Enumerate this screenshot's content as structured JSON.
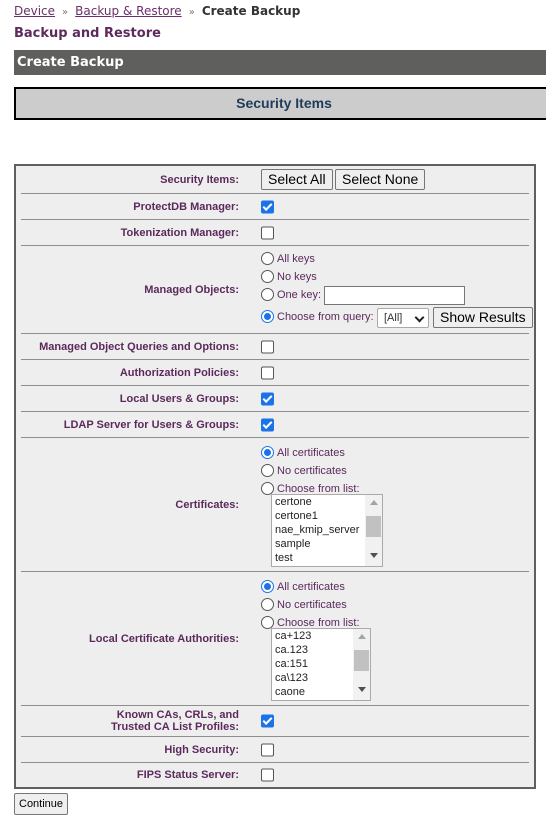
{
  "breadcrumb": {
    "items": [
      "Device",
      "Backup & Restore"
    ],
    "separator": "»",
    "current": "Create Backup"
  },
  "page_title": "Backup and Restore",
  "section_title": "Create Backup",
  "items_header": "Security Items",
  "form": {
    "security_items": {
      "label": "Security Items:",
      "select_all": "Select All",
      "select_none": "Select None"
    },
    "protectdb": {
      "label": "ProtectDB Manager:",
      "checked": true
    },
    "tokenization": {
      "label": "Tokenization Manager:",
      "checked": false
    },
    "managed_objects": {
      "label": "Managed Objects:",
      "options": [
        "All keys",
        "No keys",
        "One key:",
        "Choose from query:"
      ],
      "selected": "Choose from query:",
      "one_key_value": "",
      "query_select": "[All]",
      "show_results": "Show Results"
    },
    "mo_queries": {
      "label": "Managed Object Queries and Options:",
      "checked": false
    },
    "auth_policies": {
      "label": "Authorization Policies:",
      "checked": false
    },
    "local_users": {
      "label": "Local Users & Groups:",
      "checked": true
    },
    "ldap": {
      "label": "LDAP Server for Users & Groups:",
      "checked": true
    },
    "certificates": {
      "label": "Certificates:",
      "options": [
        "All certificates",
        "No certificates",
        "Choose from list:"
      ],
      "selected": "All certificates",
      "list": [
        "certone",
        "certone1",
        "nae_kmip_server",
        "sample",
        "test"
      ]
    },
    "local_cas": {
      "label": "Local Certificate Authorities:",
      "options": [
        "All certificates",
        "No certificates",
        "Choose from list:"
      ],
      "selected": "All certificates",
      "list": [
        "ca+123",
        "ca.123",
        "ca:151",
        "ca\\123",
        "caone"
      ]
    },
    "known_cas": {
      "label_line1": "Known CAs, CRLs, and",
      "label_line2": "Trusted CA List Profiles:",
      "checked": true
    },
    "high_security": {
      "label": "High Security:",
      "checked": false
    },
    "fips": {
      "label": "FIPS Status Server:",
      "checked": false
    }
  },
  "continue_label": "Continue",
  "colors": {
    "accent": "#1a73e8",
    "label": "#5b2a5b",
    "section_bar": "#5f5f5d"
  }
}
